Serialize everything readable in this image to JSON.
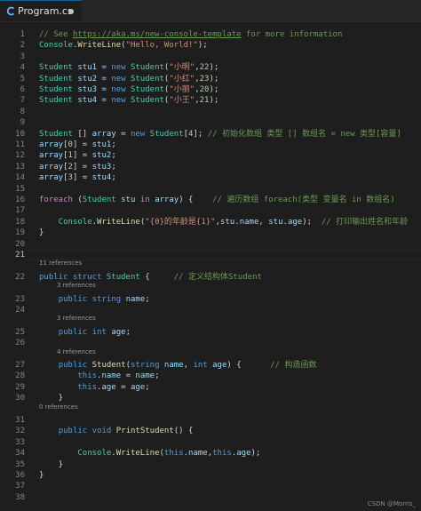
{
  "tab": {
    "title": "Program.cs",
    "icon": "csharp-file-icon",
    "dirty": true,
    "accent": "#0e639c"
  },
  "watermark": "CSDN @Morris_",
  "theme": {
    "comment": "#6a9955",
    "type": "#4ec9b0",
    "keyword": "#569cd6",
    "control": "#c586c0",
    "variable": "#9cdcfe",
    "string": "#ce9178",
    "number": "#b5cea8",
    "function": "#dcdcaa",
    "plain": "#d4d4d4"
  },
  "active_line": 21,
  "lines": [
    {
      "n": "1",
      "lens": "",
      "t": [
        [
          "// See ",
          "comment"
        ],
        [
          "https://aka.ms/new-console-template",
          "link"
        ],
        [
          " for more information",
          "comment"
        ]
      ]
    },
    {
      "n": "2",
      "lens": "",
      "t": [
        [
          "Console",
          "type"
        ],
        [
          ".",
          "p"
        ],
        [
          "WriteLine",
          "fn"
        ],
        [
          "(",
          "p"
        ],
        [
          "\"Hello, World!\"",
          "str"
        ],
        [
          ");",
          "p"
        ]
      ]
    },
    {
      "n": "3",
      "lens": "",
      "t": []
    },
    {
      "n": "4",
      "lens": "",
      "t": [
        [
          "Student",
          "type"
        ],
        [
          " stu1 = ",
          "var"
        ],
        [
          "new",
          "kw"
        ],
        [
          " ",
          "p"
        ],
        [
          "Student",
          "type"
        ],
        [
          "(",
          "p"
        ],
        [
          "\"小明\"",
          "str"
        ],
        [
          ",",
          "p"
        ],
        [
          "22",
          "num"
        ],
        [
          ");",
          "p"
        ]
      ]
    },
    {
      "n": "5",
      "lens": "",
      "t": [
        [
          "Student",
          "type"
        ],
        [
          " stu2 = ",
          "var"
        ],
        [
          "new",
          "kw"
        ],
        [
          " ",
          "p"
        ],
        [
          "Student",
          "type"
        ],
        [
          "(",
          "p"
        ],
        [
          "\"小红\"",
          "str"
        ],
        [
          ",",
          "p"
        ],
        [
          "23",
          "num"
        ],
        [
          ");",
          "p"
        ]
      ]
    },
    {
      "n": "6",
      "lens": "",
      "t": [
        [
          "Student",
          "type"
        ],
        [
          " stu3 = ",
          "var"
        ],
        [
          "new",
          "kw"
        ],
        [
          " ",
          "p"
        ],
        [
          "Student",
          "type"
        ],
        [
          "(",
          "p"
        ],
        [
          "\"小丽\"",
          "str"
        ],
        [
          ",",
          "p"
        ],
        [
          "20",
          "num"
        ],
        [
          ");",
          "p"
        ]
      ]
    },
    {
      "n": "7",
      "lens": "",
      "t": [
        [
          "Student",
          "type"
        ],
        [
          " stu4 = ",
          "var"
        ],
        [
          "new",
          "kw"
        ],
        [
          " ",
          "p"
        ],
        [
          "Student",
          "type"
        ],
        [
          "(",
          "p"
        ],
        [
          "\"小王\"",
          "str"
        ],
        [
          ",",
          "p"
        ],
        [
          "21",
          "num"
        ],
        [
          ");",
          "p"
        ]
      ]
    },
    {
      "n": "8",
      "lens": "",
      "t": []
    },
    {
      "n": "9",
      "lens": "",
      "t": []
    },
    {
      "n": "10",
      "lens": "",
      "t": [
        [
          "Student",
          "type"
        ],
        [
          " [] ",
          "p"
        ],
        [
          "array",
          "var"
        ],
        [
          " = ",
          "p"
        ],
        [
          "new",
          "kw"
        ],
        [
          " ",
          "p"
        ],
        [
          "Student",
          "type"
        ],
        [
          "[",
          "p"
        ],
        [
          "4",
          "num"
        ],
        [
          "]; ",
          "p"
        ],
        [
          "// 初始化数组 类型 [] 数组名 = new 类型[容量]",
          "comment"
        ]
      ]
    },
    {
      "n": "11",
      "lens": "",
      "t": [
        [
          "array",
          "var"
        ],
        [
          "[",
          "p"
        ],
        [
          "0",
          "num"
        ],
        [
          "] = ",
          "p"
        ],
        [
          "stu1",
          "var"
        ],
        [
          ";",
          "p"
        ]
      ]
    },
    {
      "n": "12",
      "lens": "",
      "t": [
        [
          "array",
          "var"
        ],
        [
          "[",
          "p"
        ],
        [
          "1",
          "num"
        ],
        [
          "] = ",
          "p"
        ],
        [
          "stu2",
          "var"
        ],
        [
          ";",
          "p"
        ]
      ]
    },
    {
      "n": "13",
      "lens": "",
      "t": [
        [
          "array",
          "var"
        ],
        [
          "[",
          "p"
        ],
        [
          "2",
          "num"
        ],
        [
          "] = ",
          "p"
        ],
        [
          "stu3",
          "var"
        ],
        [
          ";",
          "p"
        ]
      ]
    },
    {
      "n": "14",
      "lens": "",
      "t": [
        [
          "array",
          "var"
        ],
        [
          "[",
          "p"
        ],
        [
          "3",
          "num"
        ],
        [
          "] = ",
          "p"
        ],
        [
          "stu4",
          "var"
        ],
        [
          ";",
          "p"
        ]
      ]
    },
    {
      "n": "15",
      "lens": "",
      "t": []
    },
    {
      "n": "16",
      "lens": "",
      "t": [
        [
          "foreach",
          "ctrl"
        ],
        [
          " (",
          "p"
        ],
        [
          "Student",
          "type"
        ],
        [
          " ",
          "p"
        ],
        [
          "stu",
          "var"
        ],
        [
          " ",
          "p"
        ],
        [
          "in",
          "ctrl"
        ],
        [
          " ",
          "p"
        ],
        [
          "array",
          "var"
        ],
        [
          ") {    ",
          "p"
        ],
        [
          "// 遍历数组 foreach(类型 变量名 in 数组名)",
          "comment"
        ]
      ]
    },
    {
      "n": "17",
      "lens": "",
      "t": []
    },
    {
      "n": "18",
      "lens": "",
      "t": [
        [
          "    ",
          "p"
        ],
        [
          "Console",
          "type"
        ],
        [
          ".",
          "p"
        ],
        [
          "WriteLine",
          "fn"
        ],
        [
          "(",
          "p"
        ],
        [
          "\"{0}的年龄是{1}\"",
          "str"
        ],
        [
          ",",
          "p"
        ],
        [
          "stu",
          "var"
        ],
        [
          ".",
          "p"
        ],
        [
          "name",
          "var"
        ],
        [
          ", ",
          "p"
        ],
        [
          "stu",
          "var"
        ],
        [
          ".",
          "p"
        ],
        [
          "age",
          "var"
        ],
        [
          ");  ",
          "p"
        ],
        [
          "// 打印输出姓名和年龄",
          "comment"
        ]
      ]
    },
    {
      "n": "19",
      "lens": "",
      "t": [
        [
          "}",
          "p"
        ]
      ]
    },
    {
      "n": "20",
      "lens": "",
      "t": []
    },
    {
      "n": "21",
      "lens": "",
      "t": []
    },
    {
      "n": "22",
      "lens": "11 references",
      "t": [
        [
          "public",
          "kw"
        ],
        [
          " ",
          "p"
        ],
        [
          "struct",
          "kw"
        ],
        [
          " ",
          "p"
        ],
        [
          "Student",
          "type"
        ],
        [
          " {     ",
          "p"
        ],
        [
          "// 定义结构体Student",
          "comment"
        ]
      ]
    },
    {
      "n": "23",
      "lens": "3 references",
      "t": [
        [
          "    ",
          "p"
        ],
        [
          "public",
          "kw"
        ],
        [
          " ",
          "p"
        ],
        [
          "string",
          "kw"
        ],
        [
          " ",
          "p"
        ],
        [
          "name",
          "var"
        ],
        [
          ";",
          "p"
        ]
      ]
    },
    {
      "n": "24",
      "lens": "",
      "t": []
    },
    {
      "n": "25",
      "lens": "3 references",
      "t": [
        [
          "    ",
          "p"
        ],
        [
          "public",
          "kw"
        ],
        [
          " ",
          "p"
        ],
        [
          "int",
          "kw"
        ],
        [
          " ",
          "p"
        ],
        [
          "age",
          "var"
        ],
        [
          ";",
          "p"
        ]
      ]
    },
    {
      "n": "26",
      "lens": "",
      "t": []
    },
    {
      "n": "27",
      "lens": "4 references",
      "t": [
        [
          "    ",
          "p"
        ],
        [
          "public",
          "kw"
        ],
        [
          " ",
          "p"
        ],
        [
          "Student",
          "fn"
        ],
        [
          "(",
          "p"
        ],
        [
          "string",
          "kw"
        ],
        [
          " ",
          "p"
        ],
        [
          "name",
          "var"
        ],
        [
          ", ",
          "p"
        ],
        [
          "int",
          "kw"
        ],
        [
          " ",
          "p"
        ],
        [
          "age",
          "var"
        ],
        [
          ") {      ",
          "p"
        ],
        [
          "// 构造函数",
          "comment"
        ]
      ]
    },
    {
      "n": "28",
      "lens": "",
      "t": [
        [
          "        ",
          "p"
        ],
        [
          "this",
          "kw"
        ],
        [
          ".",
          "p"
        ],
        [
          "name",
          "var"
        ],
        [
          " = ",
          "p"
        ],
        [
          "name",
          "var"
        ],
        [
          ";",
          "p"
        ]
      ]
    },
    {
      "n": "29",
      "lens": "",
      "t": [
        [
          "        ",
          "p"
        ],
        [
          "this",
          "kw"
        ],
        [
          ".",
          "p"
        ],
        [
          "age",
          "var"
        ],
        [
          " = ",
          "p"
        ],
        [
          "age",
          "var"
        ],
        [
          ";",
          "p"
        ]
      ]
    },
    {
      "n": "30",
      "lens": "",
      "t": [
        [
          "    }",
          "p"
        ]
      ]
    },
    {
      "n": "31",
      "lens": "0 references",
      "t": []
    },
    {
      "n": "32",
      "lens": "",
      "t": [
        [
          "    ",
          "p"
        ],
        [
          "public",
          "kw"
        ],
        [
          " ",
          "p"
        ],
        [
          "void",
          "kw"
        ],
        [
          " ",
          "p"
        ],
        [
          "PrintStudent",
          "fn"
        ],
        [
          "() {",
          "p"
        ]
      ]
    },
    {
      "n": "33",
      "lens": "",
      "t": []
    },
    {
      "n": "34",
      "lens": "",
      "t": [
        [
          "        ",
          "p"
        ],
        [
          "Console",
          "type"
        ],
        [
          ".",
          "p"
        ],
        [
          "WriteLine",
          "fn"
        ],
        [
          "(",
          "p"
        ],
        [
          "this",
          "kw"
        ],
        [
          ".",
          "p"
        ],
        [
          "name",
          "var"
        ],
        [
          ",",
          "p"
        ],
        [
          "this",
          "kw"
        ],
        [
          ".",
          "p"
        ],
        [
          "age",
          "var"
        ],
        [
          ");",
          "p"
        ]
      ]
    },
    {
      "n": "35",
      "lens": "",
      "t": [
        [
          "    }",
          "p"
        ]
      ]
    },
    {
      "n": "36",
      "lens": "",
      "t": [
        [
          "}",
          "p"
        ]
      ]
    },
    {
      "n": "37",
      "lens": "",
      "t": []
    },
    {
      "n": "38",
      "lens": "",
      "t": []
    }
  ]
}
